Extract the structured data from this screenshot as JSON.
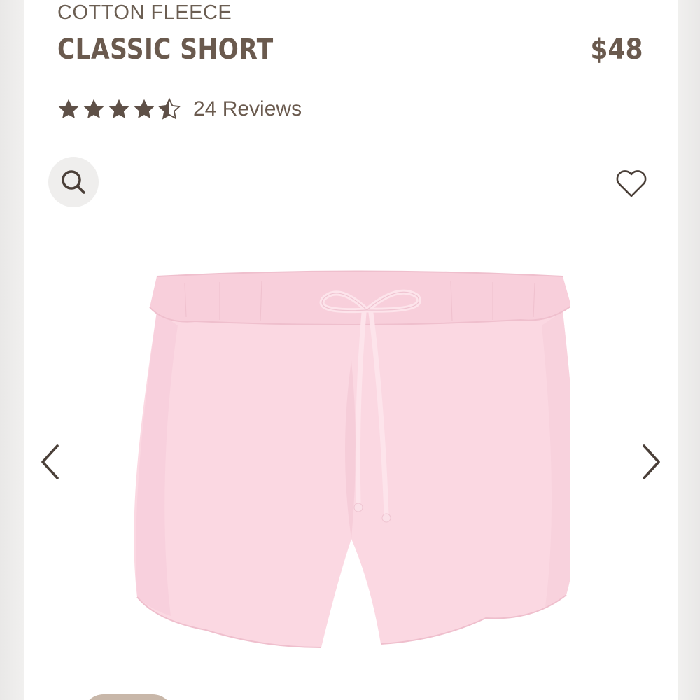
{
  "product": {
    "collection": "COTTON FLEECE",
    "name": "CLASSIC SHORT",
    "price": "$48",
    "rating": 4.5,
    "max_rating": 5,
    "reviews_label": "24 Reviews"
  },
  "icons": {
    "zoom": "search-icon",
    "favorite": "heart-icon",
    "prev": "chevron-left-icon",
    "next": "chevron-right-icon",
    "rating": "star-icon"
  },
  "colors": {
    "text": "#6a5a4e",
    "product": "#fbd8e2",
    "accent": "#c8b7a9"
  }
}
